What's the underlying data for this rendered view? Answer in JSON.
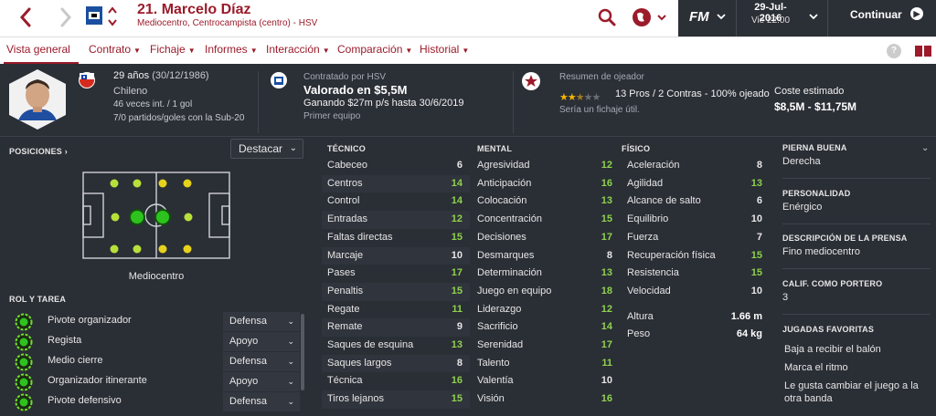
{
  "header": {
    "player_title": "21. Marcelo Díaz",
    "player_subtitle": "Mediocentro, Centrocampista (centro) - HSV",
    "date": "29-Jul-2016",
    "time": "Vie 22:00",
    "continue_label": "Continuar",
    "fm_logo": "FM"
  },
  "nav": {
    "items": [
      {
        "label": "Vista general"
      },
      {
        "label": "Contrato"
      },
      {
        "label": "Fichaje"
      },
      {
        "label": "Informes"
      },
      {
        "label": "Interacción"
      },
      {
        "label": "Comparación"
      },
      {
        "label": "Historial"
      }
    ],
    "help": "?"
  },
  "profile": {
    "age": "29 años",
    "dob": "(30/12/1986)",
    "nationality": "Chileno",
    "caps": "46 veces int. / 1 gol",
    "u20": "7/0 partidos/goles con la Sub-20",
    "contract_by": "Contratado por HSV",
    "value": "Valorado en $5,5M",
    "wage": "Ganando $27m p/s hasta 30/6/2019",
    "squad": "Primer equipo",
    "scout_title": "Resumen de ojeador",
    "scout_summary": "13 Pros / 2 Contras - 100% ojeado",
    "scout_note": "Sería un fichaje útil.",
    "rating_stars": 2.5,
    "cost_label": "Coste estimado",
    "cost_value": "$8,5M - $11,75M"
  },
  "positions": {
    "label": "POSICIONES",
    "highlight": "Destacar",
    "position_name": "Mediocentro"
  },
  "roles": {
    "label": "ROL Y TAREA",
    "items": [
      {
        "name": "Pivote organizador",
        "duty": "Defensa"
      },
      {
        "name": "Regista",
        "duty": "Apoyo"
      },
      {
        "name": "Medio cierre",
        "duty": "Defensa"
      },
      {
        "name": "Organizador itinerante",
        "duty": "Apoyo"
      },
      {
        "name": "Pivote defensivo",
        "duty": "Defensa"
      }
    ]
  },
  "technical": {
    "label": "TÉCNICO",
    "attrs": [
      {
        "name": "Cabeceo",
        "value": 6
      },
      {
        "name": "Centros",
        "value": 14
      },
      {
        "name": "Control",
        "value": 14
      },
      {
        "name": "Entradas",
        "value": 12
      },
      {
        "name": "Faltas directas",
        "value": 15
      },
      {
        "name": "Marcaje",
        "value": 10
      },
      {
        "name": "Pases",
        "value": 17
      },
      {
        "name": "Penaltis",
        "value": 15
      },
      {
        "name": "Regate",
        "value": 11
      },
      {
        "name": "Remate",
        "value": 9
      },
      {
        "name": "Saques de esquina",
        "value": 13
      },
      {
        "name": "Saques largos",
        "value": 8
      },
      {
        "name": "Técnica",
        "value": 16
      },
      {
        "name": "Tiros lejanos",
        "value": 15
      }
    ]
  },
  "mental": {
    "label": "MENTAL",
    "attrs": [
      {
        "name": "Agresividad",
        "value": 12
      },
      {
        "name": "Anticipación",
        "value": 16
      },
      {
        "name": "Colocación",
        "value": 13
      },
      {
        "name": "Concentración",
        "value": 15
      },
      {
        "name": "Decisiones",
        "value": 17
      },
      {
        "name": "Desmarques",
        "value": 8
      },
      {
        "name": "Determinación",
        "value": 13
      },
      {
        "name": "Juego en equipo",
        "value": 18
      },
      {
        "name": "Liderazgo",
        "value": 12
      },
      {
        "name": "Sacrificio",
        "value": 14
      },
      {
        "name": "Serenidad",
        "value": 17
      },
      {
        "name": "Talento",
        "value": 11
      },
      {
        "name": "Valentía",
        "value": 10
      },
      {
        "name": "Visión",
        "value": 16
      }
    ]
  },
  "physical": {
    "label": "FÍSICO",
    "attrs": [
      {
        "name": "Aceleración",
        "value": 8
      },
      {
        "name": "Agilidad",
        "value": 13
      },
      {
        "name": "Alcance de salto",
        "value": 6
      },
      {
        "name": "Equilibrio",
        "value": 10
      },
      {
        "name": "Fuerza",
        "value": 7
      },
      {
        "name": "Recuperación física",
        "value": 15
      },
      {
        "name": "Resistencia",
        "value": 15
      },
      {
        "name": "Velocidad",
        "value": 10
      }
    ],
    "height_label": "Altura",
    "height_value": "1.66 m",
    "weight_label": "Peso",
    "weight_value": "64 kg"
  },
  "details": {
    "foot_label": "PIERNA BUENA",
    "foot_value": "Derecha",
    "personality_label": "PERSONALIDAD",
    "personality_value": "Enérgico",
    "press_label": "DESCRIPCIÓN DE LA PRENSA",
    "press_value": "Fino mediocentro",
    "gk_label": "CALIF. COMO PORTERO",
    "gk_value": "3",
    "moves_label": "JUGADAS FAVORITAS",
    "moves": [
      "Baja a recibir el balón",
      "Marca el ritmo",
      "Le gusta cambiar el juego a la otra banda"
    ]
  },
  "colors": {
    "accent": "#9b1b2a",
    "high": "#8fd14f",
    "mid": "#e6e6e6",
    "panel": "#2b2f36",
    "bg": "#2a2e35"
  }
}
